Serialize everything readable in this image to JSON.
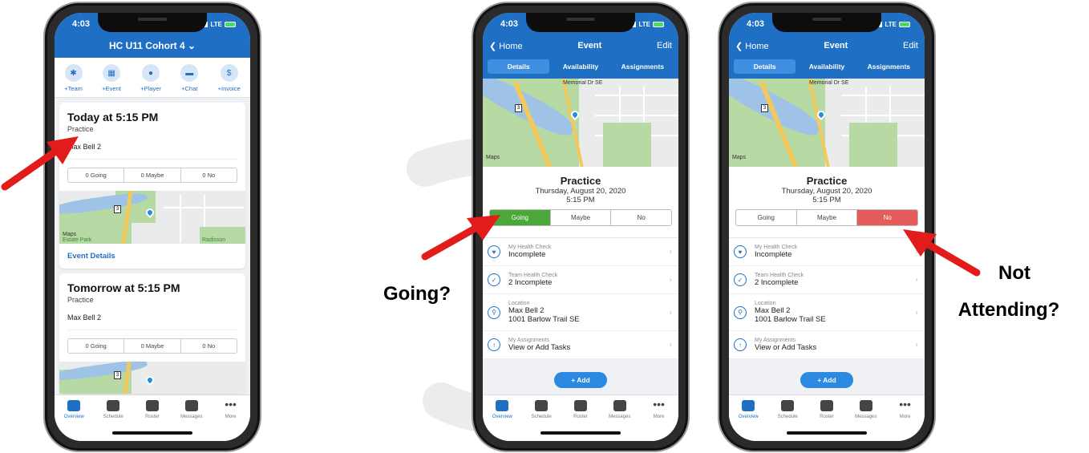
{
  "phone1": {
    "status_time": "4:03",
    "status_network": "LTE",
    "team_selector": "HC U11 Cohort 4",
    "quick_actions": [
      "+Team",
      "+Event",
      "+Player",
      "+Chat",
      "+Invoice"
    ],
    "events": [
      {
        "title": "Today at 5:15 PM",
        "type": "Practice",
        "location": "Max Bell 2",
        "going": "0 Going",
        "maybe": "0 Maybe",
        "no": "0 No",
        "link": "Event Details"
      },
      {
        "title": "Tomorrow at 5:15 PM",
        "type": "Practice",
        "location": "Max Bell 2",
        "going": "0 Going",
        "maybe": "0 Maybe",
        "no": "0 No"
      }
    ],
    "map_label": "Maps",
    "map_park_label": "Estate Park",
    "map_place_label": "Radisson",
    "shield": "3"
  },
  "event_screen": {
    "status_time": "4:03",
    "status_network": "LTE",
    "back_label": "Home",
    "title": "Event",
    "edit_label": "Edit",
    "tabs": [
      "Details",
      "Availability",
      "Assignments"
    ],
    "map_label": "Maps",
    "map_street": "Memorial Dr SE",
    "shield": "3",
    "event_title": "Practice",
    "event_date": "Thursday, August 20, 2020",
    "event_time": "5:15 PM",
    "rsvp": [
      "Going",
      "Maybe",
      "No"
    ],
    "rows": [
      {
        "label": "My Health Check",
        "value": "Incomplete",
        "value2": ""
      },
      {
        "label": "Team Health Check",
        "value": "2 Incomplete",
        "value2": ""
      },
      {
        "label": "Location",
        "value": "Max Bell 2",
        "value2": "1001 Barlow Trail SE"
      },
      {
        "label": "My Assignments",
        "value": "View or Add Tasks",
        "value2": ""
      }
    ],
    "add_button": "+ Add"
  },
  "tabbar": [
    "Overview",
    "Schedule",
    "Roster",
    "Messages",
    "More"
  ],
  "annotations": {
    "going": "Going?",
    "not_attending_1": "Not",
    "not_attending_2": "Attending?"
  },
  "colors": {
    "brand_blue": "#1f6fc4",
    "going_green": "#4aa83b",
    "no_red": "#e45c5c",
    "arrow_red": "#e21b1b"
  }
}
